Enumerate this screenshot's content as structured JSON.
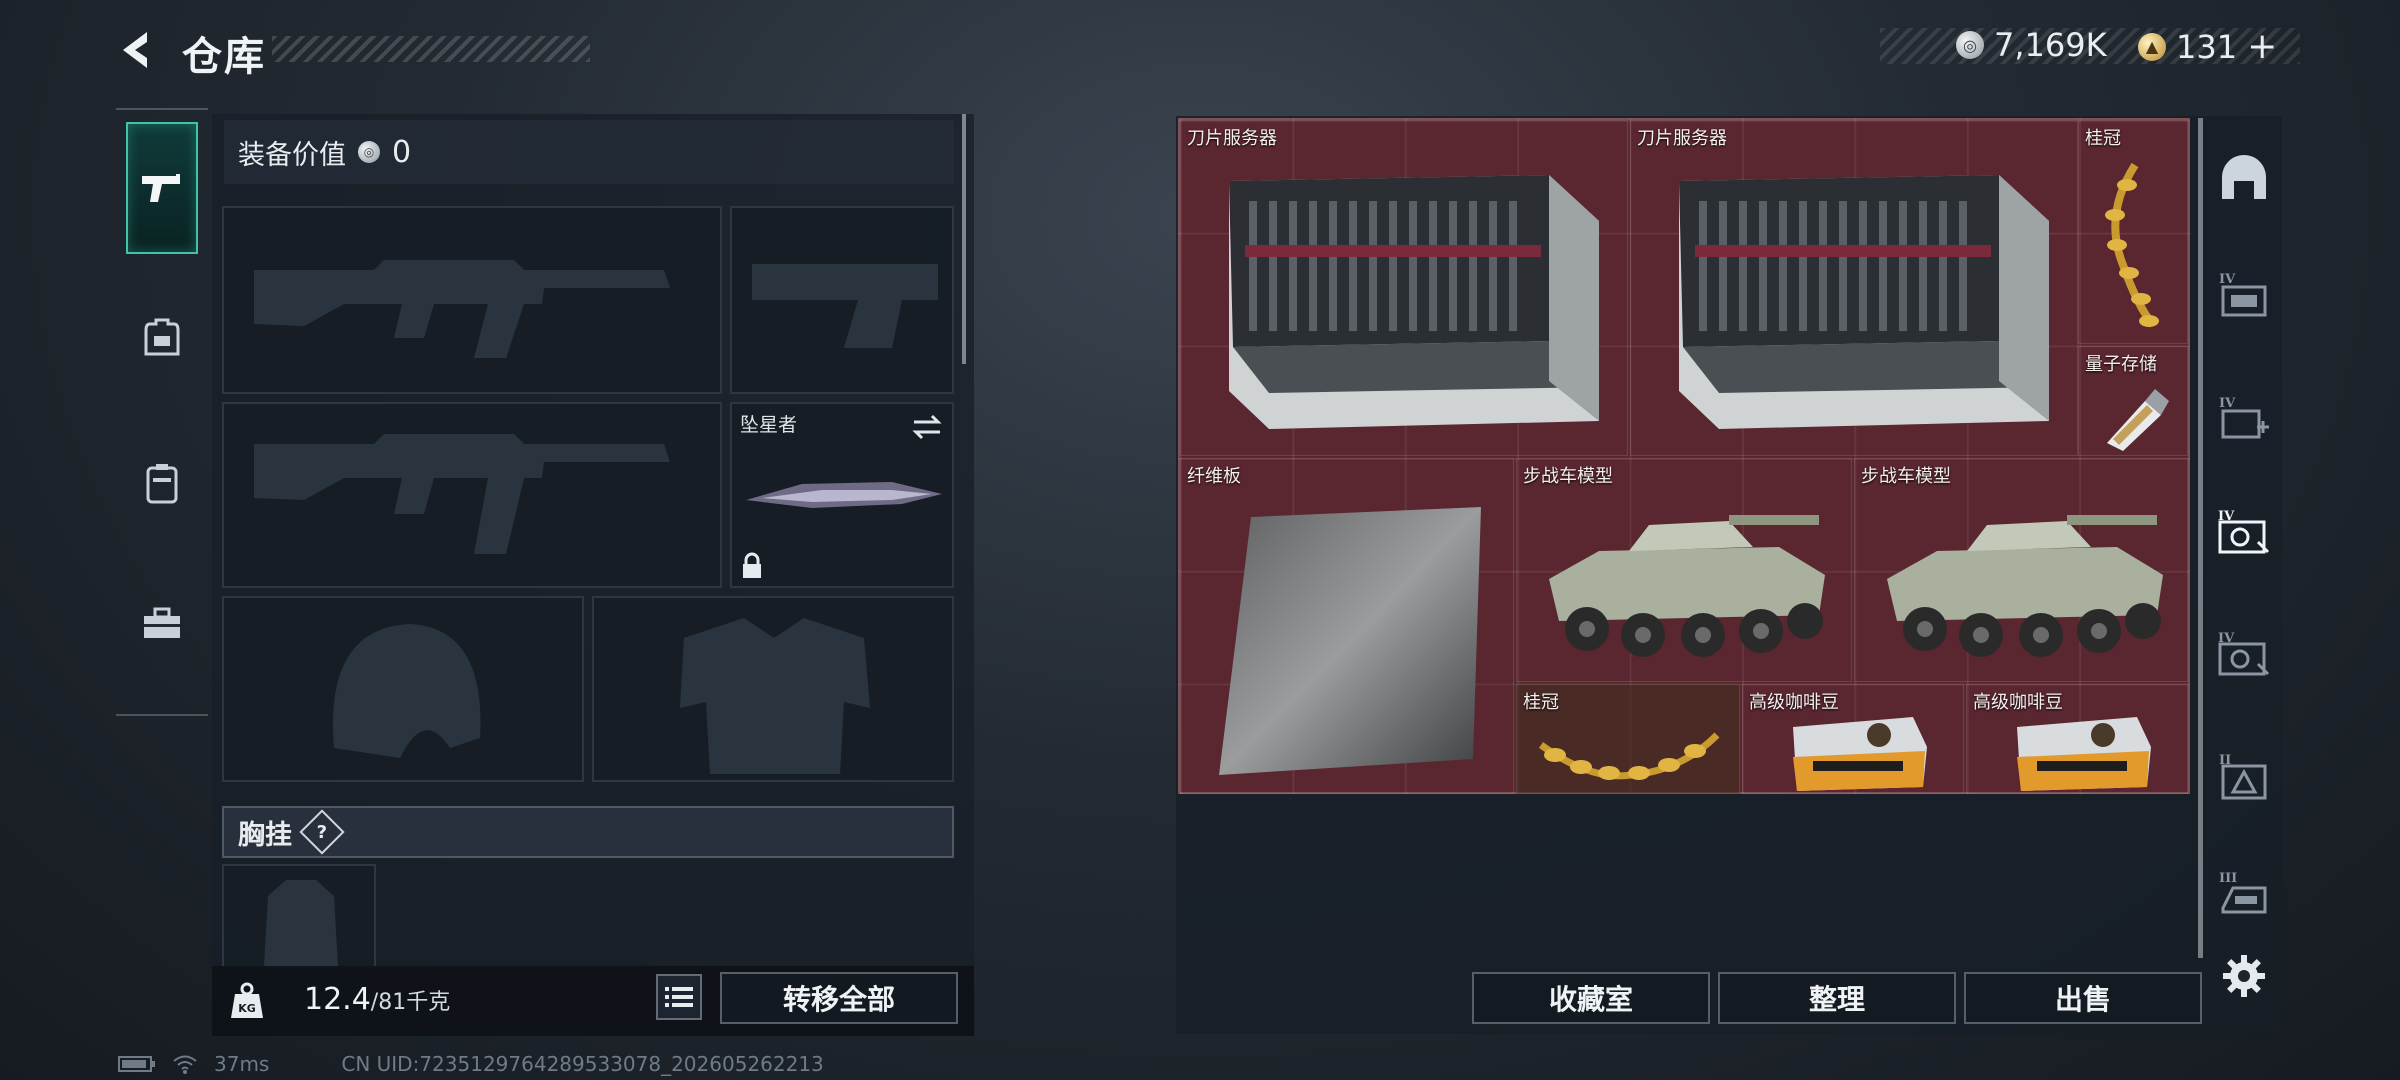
{
  "header": {
    "title": "仓库",
    "currency": [
      {
        "icon": "silver-coin-icon",
        "value": "7,169K"
      },
      {
        "icon": "gold-coin-icon",
        "value": "131",
        "add": "+"
      }
    ]
  },
  "left_rail": {
    "tabs": [
      {
        "icon": "pistol-icon",
        "active": true
      },
      {
        "icon": "backpack-icon",
        "active": false
      },
      {
        "icon": "locker-icon",
        "active": false
      },
      {
        "icon": "toolbox-icon",
        "active": false
      }
    ]
  },
  "equipment": {
    "value_label": "装备价值",
    "value": "0",
    "slots": {
      "primary_1": {
        "icon": "assault-rifle-icon"
      },
      "secondary": {
        "icon": "handgun-icon"
      },
      "primary_2": {
        "icon": "assault-rifle-icon"
      },
      "melee": {
        "name": "坠星者",
        "icon": "knife-icon",
        "locked": true,
        "swap_icon": "swap-icon"
      },
      "helmet": {
        "icon": "helmet-icon"
      },
      "armor": {
        "icon": "body-armor-icon"
      }
    },
    "chest_rig_label": "胸挂",
    "help": "?",
    "weight_current": "12.4",
    "weight_max": "/81千克",
    "transfer_all": "转移全部"
  },
  "storage": {
    "items": [
      {
        "name": "刀片服务器",
        "icon": "blade-server-icon"
      },
      {
        "name": "刀片服务器",
        "icon": "blade-server-icon"
      },
      {
        "name": "桂冠",
        "icon": "laurel-crown-icon"
      },
      {
        "name": "量子存储",
        "icon": "usb-drive-icon"
      },
      {
        "name": "纤维板",
        "icon": "fiber-board-icon"
      },
      {
        "name": "步战车模型",
        "icon": "ifv-model-icon"
      },
      {
        "name": "步战车模型",
        "icon": "ifv-model-icon"
      },
      {
        "name": "桂冠",
        "icon": "laurel-crown-icon"
      },
      {
        "name": "高级咖啡豆",
        "icon": "coffee-beans-icon"
      },
      {
        "name": "高级咖啡豆",
        "icon": "coffee-beans-icon"
      }
    ],
    "buttons": {
      "collection": "收藏室",
      "sort": "整理",
      "sell": "出售"
    }
  },
  "right_rail": {
    "items": [
      {
        "icon": "arch-icon"
      },
      {
        "icon": "tier-4-case-icon",
        "tier": "IV"
      },
      {
        "icon": "tier-4-medkit-case-icon",
        "tier": "IV"
      },
      {
        "icon": "tier-4-camera-case-icon",
        "tier": "IV"
      },
      {
        "icon": "tier-4-camera-case-icon",
        "tier": "IV"
      },
      {
        "icon": "tier-2-warning-case-icon",
        "tier": "II"
      },
      {
        "icon": "tier-3-case-icon",
        "tier": "III"
      },
      {
        "icon": "gear-icon"
      }
    ]
  },
  "status": {
    "ping": "37ms",
    "uid": "CN UID:7235129764289533078_202605262213"
  },
  "colors": {
    "accent": "#3fc3a9",
    "storage_bg": "#5a2630"
  }
}
